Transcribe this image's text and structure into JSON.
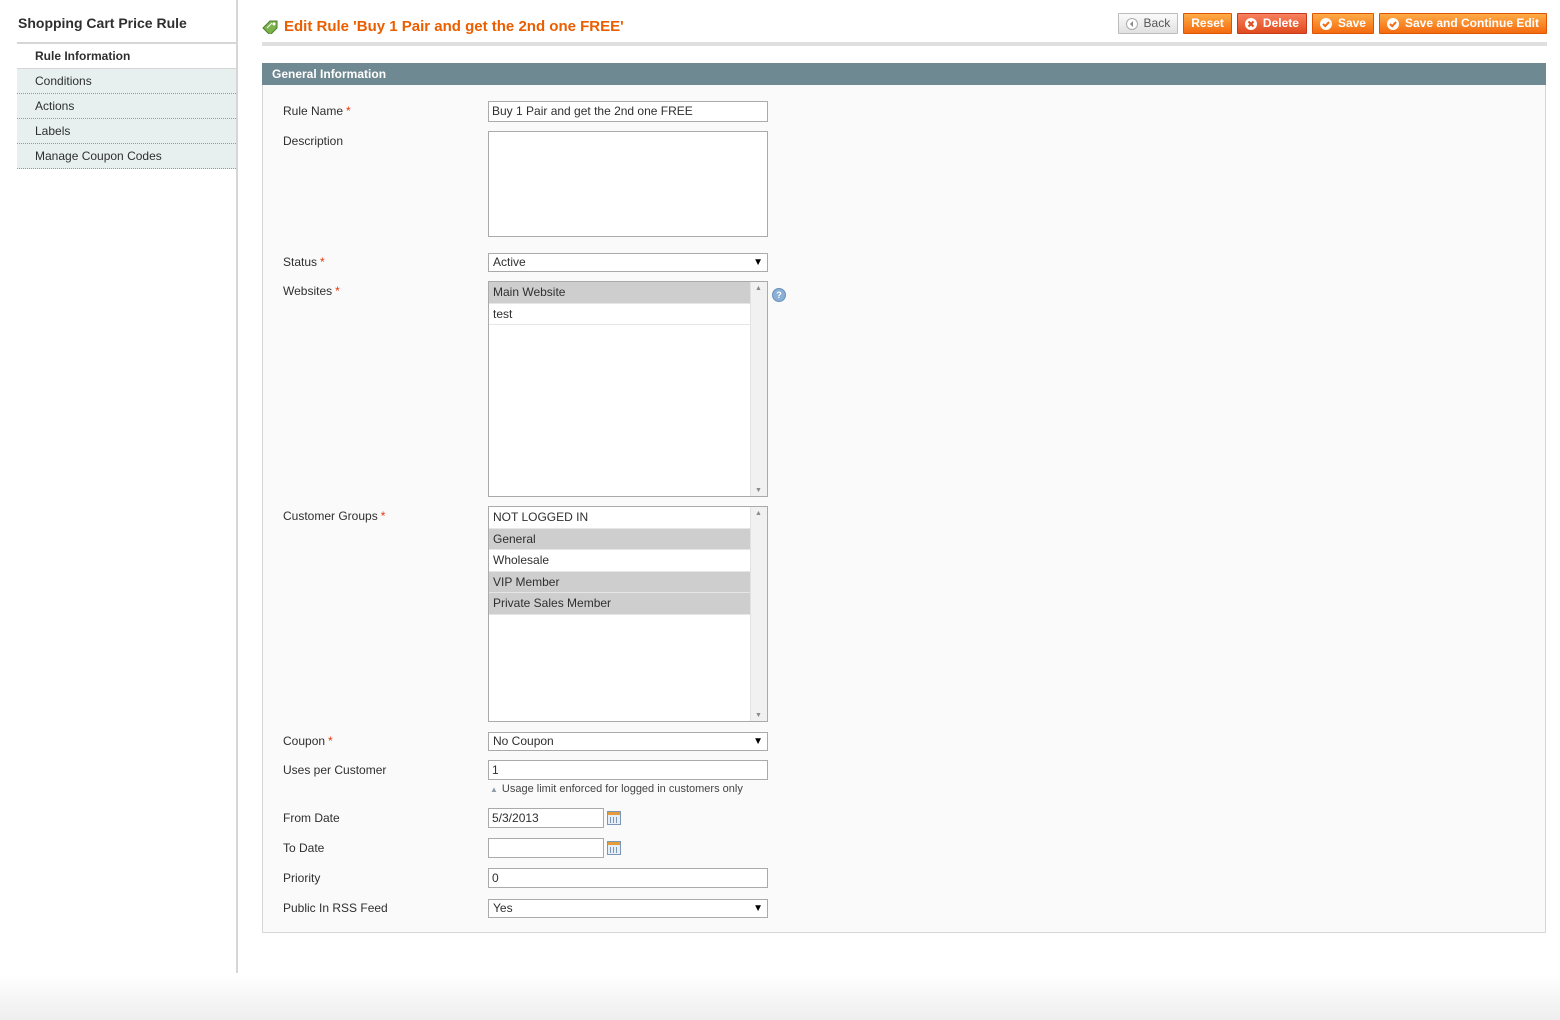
{
  "sidebar": {
    "title": "Shopping Cart Price Rule",
    "tabs": [
      {
        "label": "Rule Information",
        "active": true
      },
      {
        "label": "Conditions",
        "active": false
      },
      {
        "label": "Actions",
        "active": false
      },
      {
        "label": "Labels",
        "active": false
      },
      {
        "label": "Manage Coupon Codes",
        "active": false
      }
    ]
  },
  "header": {
    "title": "Edit Rule 'Buy 1 Pair and get the 2nd one FREE'",
    "icon": "edit-tag-icon",
    "buttons": {
      "back": "Back",
      "reset": "Reset",
      "delete": "Delete",
      "save": "Save",
      "save_continue": "Save and Continue Edit"
    }
  },
  "section": {
    "title": "General Information"
  },
  "form": {
    "rule_name": {
      "label": "Rule Name",
      "required": "*",
      "value": "Buy 1 Pair and get the 2nd one FREE"
    },
    "description": {
      "label": "Description",
      "value": ""
    },
    "status": {
      "label": "Status",
      "required": "*",
      "value": "Active"
    },
    "websites": {
      "label": "Websites",
      "required": "*",
      "options": [
        {
          "label": "Main Website",
          "selected": true
        },
        {
          "label": "test",
          "selected": false
        }
      ],
      "help": "?"
    },
    "customer_groups": {
      "label": "Customer Groups",
      "required": "*",
      "options": [
        {
          "label": "NOT LOGGED IN",
          "selected": false
        },
        {
          "label": "General",
          "selected": true
        },
        {
          "label": "Wholesale",
          "selected": false
        },
        {
          "label": "VIP Member",
          "selected": true
        },
        {
          "label": "Private Sales Member",
          "selected": true
        }
      ]
    },
    "coupon": {
      "label": "Coupon",
      "required": "*",
      "value": "No Coupon"
    },
    "uses_per_customer": {
      "label": "Uses per Customer",
      "value": "1",
      "note": "Usage limit enforced for logged in customers only"
    },
    "from_date": {
      "label": "From Date",
      "value": "5/3/2013"
    },
    "to_date": {
      "label": "To Date",
      "value": ""
    },
    "priority": {
      "label": "Priority",
      "value": "0"
    },
    "public_rss": {
      "label": "Public In RSS Feed",
      "value": "Yes"
    }
  },
  "colors": {
    "accent": "#eb5e00",
    "section_header": "#6f8992",
    "button_orange": "#f47a20",
    "required": "#eb340a"
  }
}
